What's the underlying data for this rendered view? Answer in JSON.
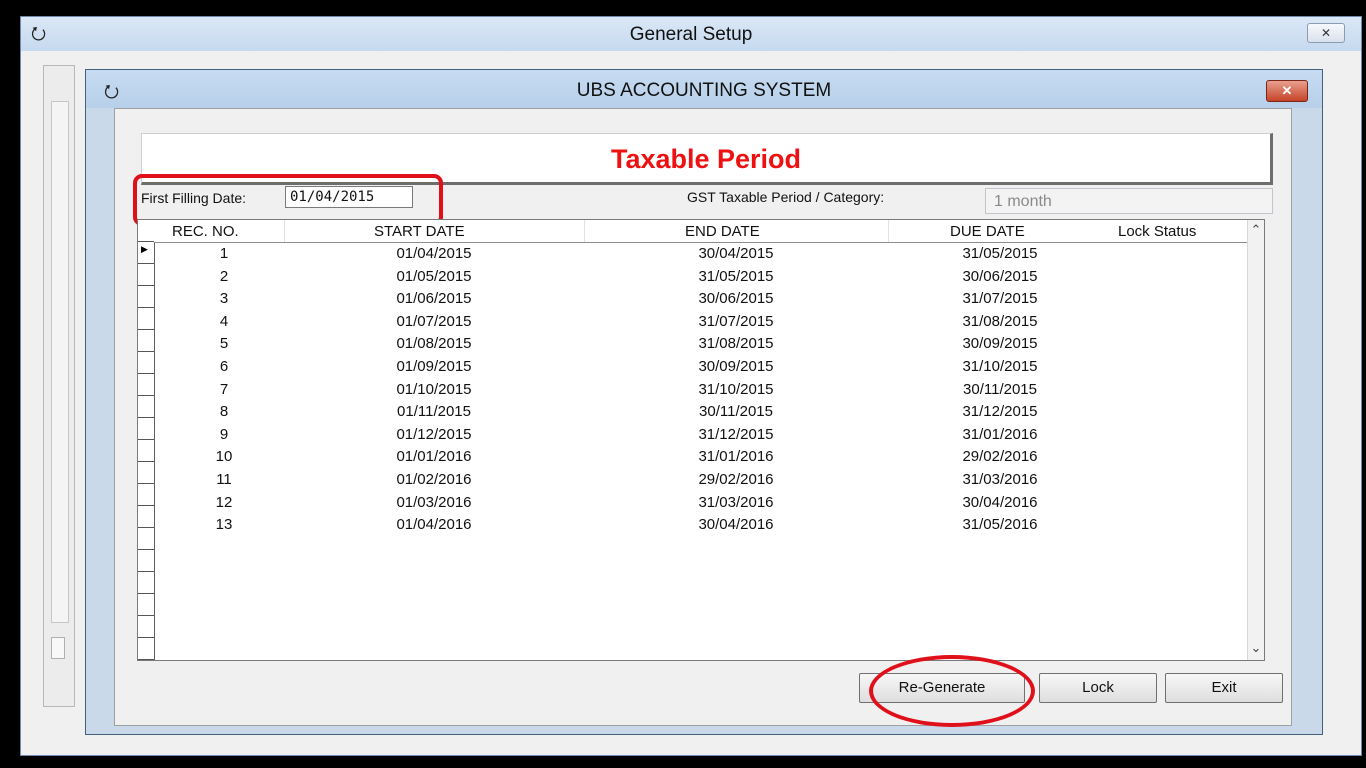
{
  "outer_window": {
    "title": "General Setup",
    "close_label": "✕",
    "icon": "book-icon"
  },
  "inner_window": {
    "title": "UBS ACCOUNTING SYSTEM",
    "close_label": "✕",
    "icon": "book-icon"
  },
  "heading": "Taxable Period",
  "first_filling": {
    "label": "First Filling Date:",
    "value": "01/04/2015"
  },
  "gst": {
    "label": "GST Taxable Period / Category:",
    "value": "1 month"
  },
  "table": {
    "columns": [
      "REC. NO.",
      "START DATE",
      "END DATE",
      "DUE DATE",
      "Lock Status"
    ],
    "rows": [
      [
        "1",
        "01/04/2015",
        "30/04/2015",
        "31/05/2015"
      ],
      [
        "2",
        "01/05/2015",
        "31/05/2015",
        "30/06/2015"
      ],
      [
        "3",
        "01/06/2015",
        "30/06/2015",
        "31/07/2015"
      ],
      [
        "4",
        "01/07/2015",
        "31/07/2015",
        "31/08/2015"
      ],
      [
        "5",
        "01/08/2015",
        "31/08/2015",
        "30/09/2015"
      ],
      [
        "6",
        "01/09/2015",
        "30/09/2015",
        "31/10/2015"
      ],
      [
        "7",
        "01/10/2015",
        "31/10/2015",
        "30/11/2015"
      ],
      [
        "8",
        "01/11/2015",
        "30/11/2015",
        "31/12/2015"
      ],
      [
        "9",
        "01/12/2015",
        "31/12/2015",
        "31/01/2016"
      ],
      [
        "10",
        "01/01/2016",
        "31/01/2016",
        "29/02/2016"
      ],
      [
        "11",
        "01/02/2016",
        "29/02/2016",
        "31/03/2016"
      ],
      [
        "12",
        "01/03/2016",
        "31/03/2016",
        "30/04/2016"
      ],
      [
        "13",
        "01/04/2016",
        "30/04/2016",
        "31/05/2016"
      ]
    ]
  },
  "buttons": {
    "regenerate": "Re-Generate",
    "lock": "Lock",
    "exit": "Exit"
  },
  "colors": {
    "heading": "#ee1111",
    "annotation": "#e0101a"
  }
}
